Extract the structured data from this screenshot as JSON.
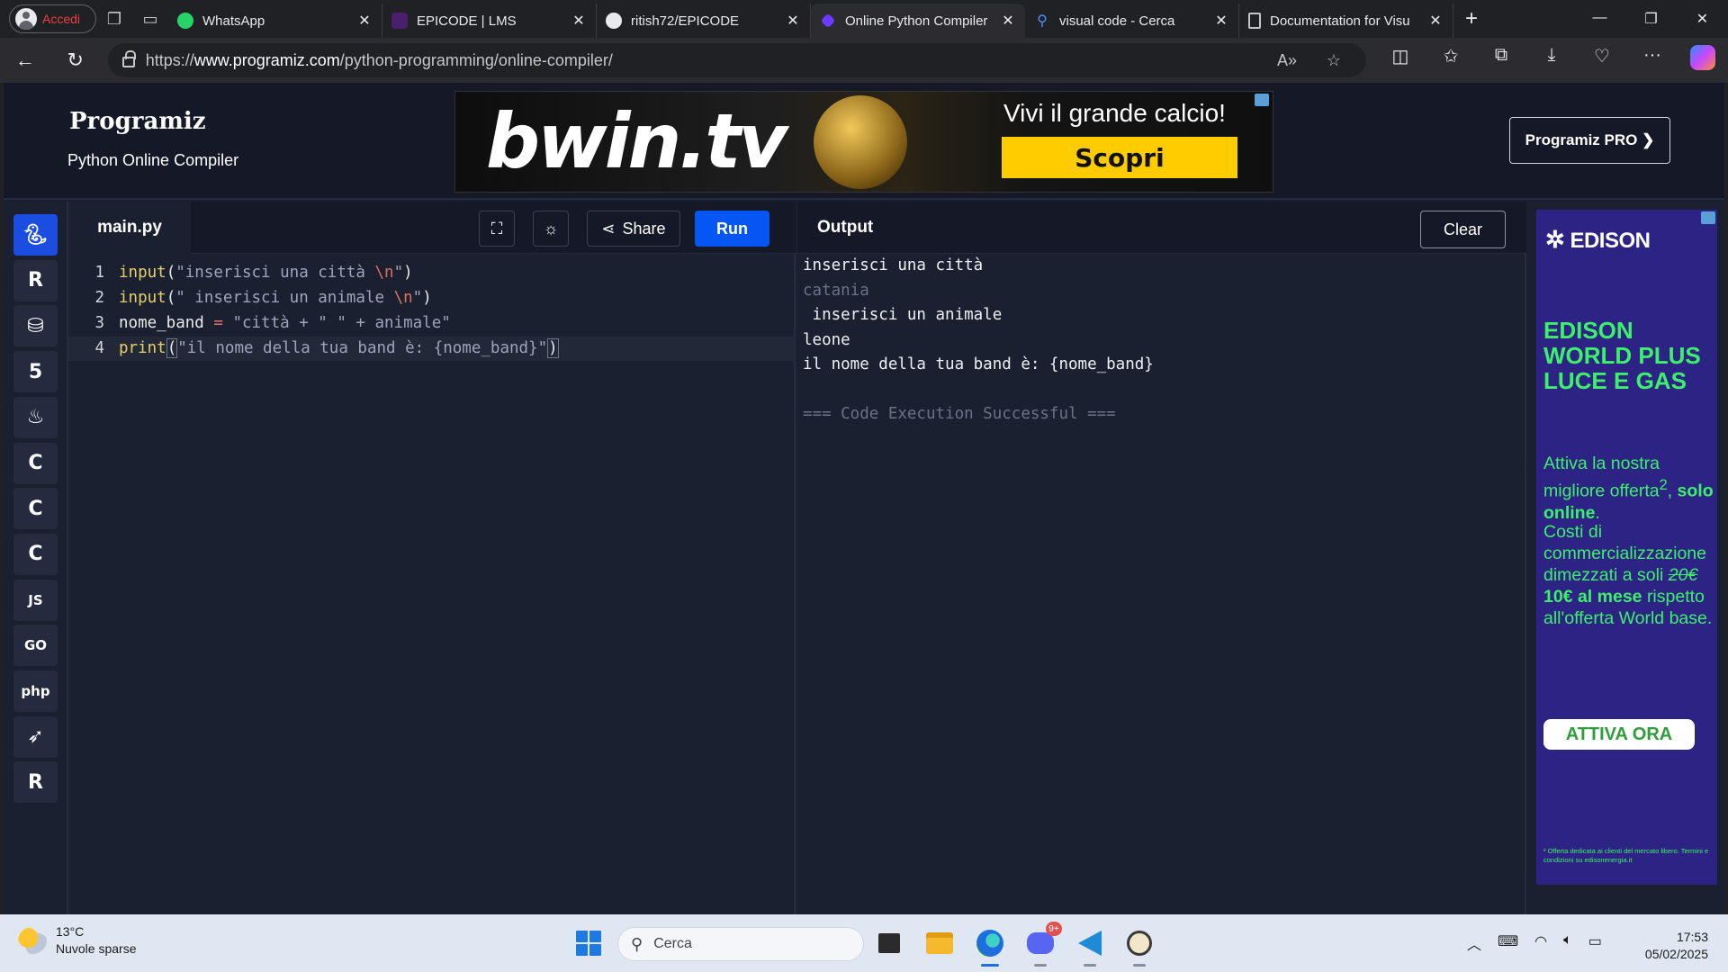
{
  "browser": {
    "profile_label": "Accedi",
    "tabs": [
      {
        "title": "WhatsApp",
        "favicon": "whatsapp-icon",
        "active": false
      },
      {
        "title": "EPICODE | LMS",
        "favicon": "epicode-icon",
        "active": false
      },
      {
        "title": "ritish72/EPICODE",
        "favicon": "github-icon",
        "active": false
      },
      {
        "title": "Online Python Compiler",
        "favicon": "programiz-icon",
        "active": true
      },
      {
        "title": "visual code - Cerca",
        "favicon": "search-icon",
        "active": false
      },
      {
        "title": "Documentation for Visu",
        "favicon": "document-icon",
        "active": false
      }
    ],
    "url_prefix": "https://",
    "url_domain": "www.programiz.com",
    "url_path": "/python-programming/online-compiler/"
  },
  "site": {
    "logo": "Programiz",
    "subtitle": "Python Online Compiler",
    "pro_button": "Programiz PRO ❯"
  },
  "top_ad": {
    "brand": "bwin.tv",
    "tagline": "Vivi il grande calcio!",
    "cta": "Scopri"
  },
  "sidebar": {
    "languages": [
      {
        "name": "python-icon",
        "label": "",
        "active": true
      },
      {
        "name": "r-icon",
        "label": "R",
        "active": false
      },
      {
        "name": "sql-icon",
        "label": "",
        "active": false
      },
      {
        "name": "html-icon",
        "label": "5",
        "active": false
      },
      {
        "name": "java-icon",
        "label": "♨",
        "active": false
      },
      {
        "name": "c-icon",
        "label": "C",
        "active": false
      },
      {
        "name": "cpp-icon",
        "label": "C",
        "active": false
      },
      {
        "name": "csharp-icon",
        "label": "C",
        "active": false
      },
      {
        "name": "javascript-icon",
        "label": "JS",
        "active": false
      },
      {
        "name": "go-icon",
        "label": "GO",
        "active": false
      },
      {
        "name": "php-icon",
        "label": "php",
        "active": false
      },
      {
        "name": "swift-icon",
        "label": "",
        "active": false
      },
      {
        "name": "rust-icon",
        "label": "R",
        "active": false
      }
    ]
  },
  "editor": {
    "filename": "main.py",
    "share_label": "Share",
    "run_label": "Run",
    "lines": [
      {
        "no": "1",
        "tokens": [
          [
            "fn",
            "input"
          ],
          [
            "id",
            "("
          ],
          [
            "str",
            "\"inserisci una città "
          ],
          [
            "esc",
            "\\n"
          ],
          [
            "str",
            "\""
          ],
          [
            "id",
            ")"
          ]
        ]
      },
      {
        "no": "2",
        "tokens": [
          [
            "fn",
            "input"
          ],
          [
            "id",
            "("
          ],
          [
            "str",
            "\" inserisci un animale "
          ],
          [
            "esc",
            "\\n"
          ],
          [
            "str",
            "\""
          ],
          [
            "id",
            ")"
          ]
        ]
      },
      {
        "no": "3",
        "tokens": [
          [
            "id",
            "nome_band "
          ],
          [
            "op",
            "="
          ],
          [
            "str",
            " \"città + \" \" + animale\""
          ]
        ]
      },
      {
        "no": "4",
        "tokens": [
          [
            "fn",
            "print"
          ],
          [
            "bracket",
            "("
          ],
          [
            "str",
            "\"il nome della tua band è: {nome_band}\""
          ],
          [
            "bracket",
            ")"
          ]
        ]
      }
    ]
  },
  "output": {
    "title": "Output",
    "clear_label": "Clear",
    "lines": [
      {
        "text": "inserisci una città",
        "kind": "normal"
      },
      {
        "text": "catania",
        "kind": "input-echo"
      },
      {
        "text": " inserisci un animale",
        "kind": "normal"
      },
      {
        "text": "leone",
        "kind": "normal"
      },
      {
        "text": "il nome della tua band è: {nome_band}",
        "kind": "normal"
      },
      {
        "text": "",
        "kind": "normal"
      },
      {
        "text": "=== Code Execution Successful ===",
        "kind": "success"
      }
    ]
  },
  "right_ad": {
    "logo": "EDISON",
    "headline": "EDISON WORLD PLUS LUCE E GAS",
    "offer_lead": "Attiva la nostra migliore offerta",
    "offer_sup": "2",
    "offer_bold": "solo online",
    "costs_lead": "Costi di commercializzazione dimezzati a soli",
    "old_price": "20€",
    "new_price": "10€ al mese",
    "costs_tail": "rispetto all'offerta World base.",
    "cta": "ATTIVA ORA",
    "fine_print": "² Offerta dedicata ai clienti del mercato libero. Termini e condizioni su edisonenergia.it"
  },
  "taskbar": {
    "temperature": "13°C",
    "weather": "Nuvole sparse",
    "search_placeholder": "Cerca",
    "discord_badge": "9+",
    "time": "17:53",
    "date": "05/02/2025"
  },
  "colors": {
    "run_button": "#0556f3",
    "page_bg": "#1b2031",
    "ad_green": "#3cf06a",
    "ad_purple": "#2d2385"
  }
}
